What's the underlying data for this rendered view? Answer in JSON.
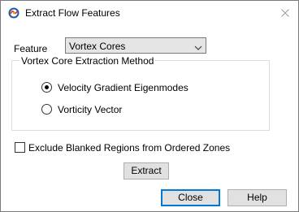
{
  "window": {
    "title": "Extract Flow Features"
  },
  "feature": {
    "label": "Feature",
    "selected": "Vortex Cores"
  },
  "method_group": {
    "legend": "Vortex Core Extraction Method",
    "options": [
      {
        "label": "Velocity Gradient Eigenmodes",
        "selected": true
      },
      {
        "label": "Vorticity Vector",
        "selected": false
      }
    ]
  },
  "exclude_blanked": {
    "label": "Exclude Blanked Regions from Ordered Zones",
    "checked": false
  },
  "buttons": {
    "extract": "Extract",
    "close": "Close",
    "help": "Help"
  },
  "icons": {
    "app": "tecplot-app-icon",
    "close": "close-icon",
    "dropdown": "chevron-down-icon"
  },
  "colors": {
    "default_button_border": "#0078d7",
    "button_face": "#e1e1e1"
  }
}
